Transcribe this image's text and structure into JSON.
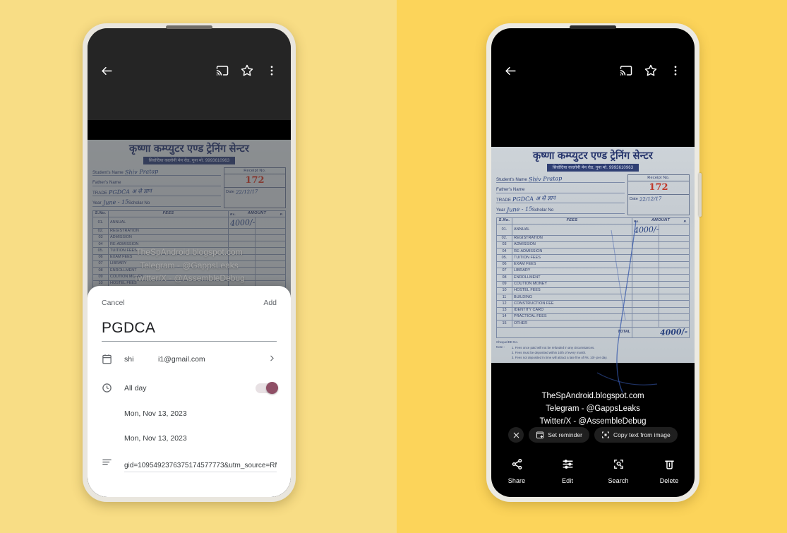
{
  "background": {
    "left_color": "#F8DD85",
    "right_color": "#FCD45A"
  },
  "watermark": {
    "line1": "TheSpAndroid.blogspot.com",
    "line2": "Telegram - @GappsLeaks",
    "line3": "Twitter/X - @AssembleDebug"
  },
  "appbar": {
    "back_icon": "back-arrow-icon",
    "cast_icon": "cast-icon",
    "star_icon": "star-icon",
    "overflow_icon": "more-vertical-icon"
  },
  "receipt": {
    "title": "कृष्णा कम्प्युटर एण्ड ट्रेनिंग सेन्टर",
    "subtitle": "सिवाेदिया कालोनी मेन रोड, गुना मो. 9993610963",
    "fields": {
      "student_label": "Student's Name",
      "student_value": "Shiv Pratap",
      "father_label": "Father's Name",
      "father_value": "",
      "trade_label": "TRADE",
      "trade_value": "PGDCA  अ  से  ज्ञान",
      "year_label": "Year",
      "year_value": "June - 15",
      "scholar_label": "Scholar No",
      "receipt_no_label": "Receipt No.",
      "receipt_no_value": "172",
      "date_label": "Date",
      "date_value": "22/12/17"
    },
    "table": {
      "headers": {
        "sno": "S.No.",
        "fees": "FEES",
        "amount": "AMOUNT",
        "rs": "Rs.",
        "p": "P."
      },
      "rows": [
        {
          "sno": "01.",
          "fees": "ANNUAL",
          "amount": "4000/-"
        },
        {
          "sno": "02.",
          "fees": "REGISTRATION",
          "amount": ""
        },
        {
          "sno": "03",
          "fees": "ADMISSION",
          "amount": ""
        },
        {
          "sno": "04",
          "fees": "RE-ADMISSION",
          "amount": ""
        },
        {
          "sno": "05.",
          "fees": "TUITION FEES",
          "amount": ""
        },
        {
          "sno": "06",
          "fees": "EXAM FEES",
          "amount": ""
        },
        {
          "sno": "07",
          "fees": "LIBRARY",
          "amount": ""
        },
        {
          "sno": "08",
          "fees": "ENROLLMENT",
          "amount": ""
        },
        {
          "sno": "09",
          "fees": "COUTION MONEY",
          "amount": ""
        },
        {
          "sno": "10",
          "fees": "HOSTEL FEES",
          "amount": ""
        },
        {
          "sno": "11",
          "fees": "BUILDING",
          "amount": ""
        },
        {
          "sno": "12",
          "fees": "CONSTRUCTION FEE",
          "amount": ""
        },
        {
          "sno": "13",
          "fees": "IDENTITY CARD",
          "amount": ""
        },
        {
          "sno": "14",
          "fees": "PRACTICAL FEES",
          "amount": ""
        },
        {
          "sno": "15",
          "fees": "OTHER",
          "amount": ""
        }
      ],
      "total_label": "TOTAL",
      "total_value": "4000/-"
    },
    "terms": {
      "cheque_label": "Cheque/DD No.",
      "note_label": "Note :",
      "items": [
        "Fees once paid will not be refunded in any circumstances.",
        "Fees must be deposited within 10th of every month.",
        "Fees not deposited in time will attract a late fine of Rs. 10/- per day."
      ]
    }
  },
  "left_phone": {
    "sheet": {
      "cancel_label": "Cancel",
      "add_label": "Add",
      "title_value": "PGDCA",
      "calendar_icon": "calendar-icon",
      "calendar_name": "shi",
      "calendar_email": "i1@gmail.com",
      "chevron_icon": "chevron-right-icon",
      "clock_icon": "clock-icon",
      "allday_label": "All day",
      "allday_toggle_on": true,
      "toggle_color": "#8F4F66",
      "start_date": "Mon, Nov 13, 2023",
      "end_date": "Mon, Nov 13, 2023",
      "notes_icon": "notes-icon",
      "url_value": "gid=1095492376375174577773&utm_source=RM"
    }
  },
  "right_phone": {
    "chips": [
      {
        "label": "",
        "icon": "close-icon",
        "name": "dismiss-chip"
      },
      {
        "label": "Set reminder",
        "icon": "calendar-add-icon",
        "name": "set-reminder-chip"
      },
      {
        "label": "Copy text from image",
        "icon": "select-text-icon",
        "name": "copy-text-chip"
      }
    ],
    "actions": [
      {
        "label": "Share",
        "icon": "share-icon"
      },
      {
        "label": "Edit",
        "icon": "edit-sliders-icon"
      },
      {
        "label": "Search",
        "icon": "lens-search-icon"
      },
      {
        "label": "Delete",
        "icon": "trash-icon"
      }
    ]
  }
}
